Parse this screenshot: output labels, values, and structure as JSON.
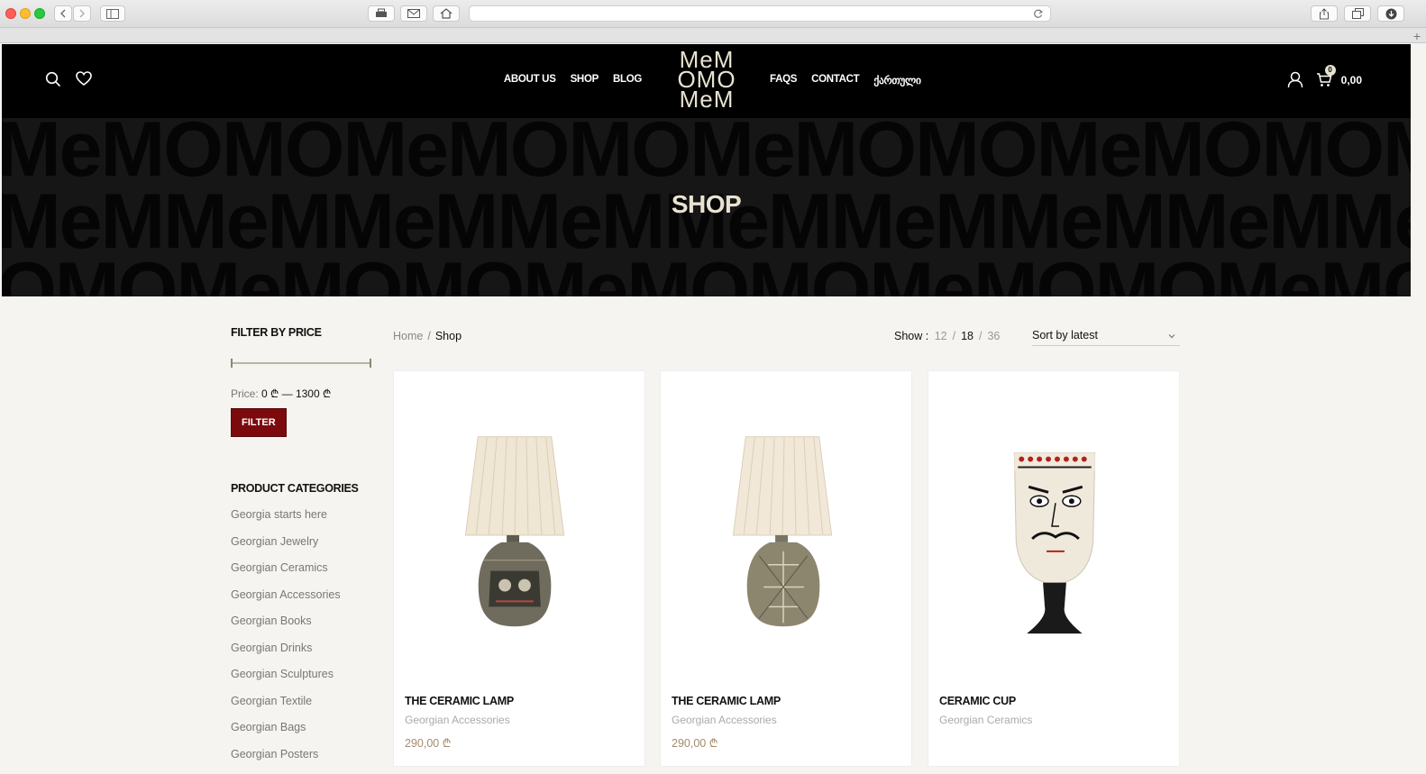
{
  "site": {
    "nav_left": [
      "ABOUT US",
      "SHOP",
      "BLOG"
    ],
    "nav_right": [
      "FAQS",
      "CONTACT",
      "ქართული"
    ],
    "logo_lines": [
      "MeM",
      "OMO",
      "MeM"
    ],
    "cart_count": "0",
    "cart_total": "0,00"
  },
  "hero": {
    "title": "SHOP",
    "pattern_rows": [
      "MeMOMOMeMOMOMeMOMOMeMOMOMeMOMOMeMOMOMeMOMOMeM",
      "MeMMeMMeMMeMMeMMeMMeMMeMMeMMeMMeMMeMMeMMeMMeM",
      "OMOMeMOMOMeMOMOMeMOMOMeMOMOMeMOMOMeMOMOMeMOMO"
    ]
  },
  "filter": {
    "title": "FILTER BY PRICE",
    "price_label": "Price:",
    "price_value": "0 ₾ — 1300 ₾",
    "button": "FILTER"
  },
  "categories": {
    "title": "PRODUCT CATEGORIES",
    "items": [
      "Georgia starts here",
      "Georgian Jewelry",
      "Georgian Ceramics",
      "Georgian Accessories",
      "Georgian Books",
      "Georgian Drinks",
      "Georgian Sculptures",
      "Georgian Textile",
      "Georgian Bags",
      "Georgian Posters"
    ]
  },
  "breadcrumb": {
    "home": "Home",
    "separator": "/",
    "current": "Shop"
  },
  "show": {
    "label": "Show :",
    "options": [
      "12",
      "18",
      "36"
    ],
    "active": "18",
    "separator": "/"
  },
  "sort": {
    "selected": "Sort by latest"
  },
  "products": [
    {
      "name": "THE CERAMIC LAMP",
      "category": "Georgian Accessories",
      "price": "290,00 ₾",
      "image": "ceramic-lamp-1"
    },
    {
      "name": "THE CERAMIC LAMP",
      "category": "Georgian Accessories",
      "price": "290,00 ₾",
      "image": "ceramic-lamp-2"
    },
    {
      "name": "CERAMIC CUP",
      "category": "Georgian Ceramics",
      "price": "",
      "image": "ceramic-cup"
    }
  ]
}
